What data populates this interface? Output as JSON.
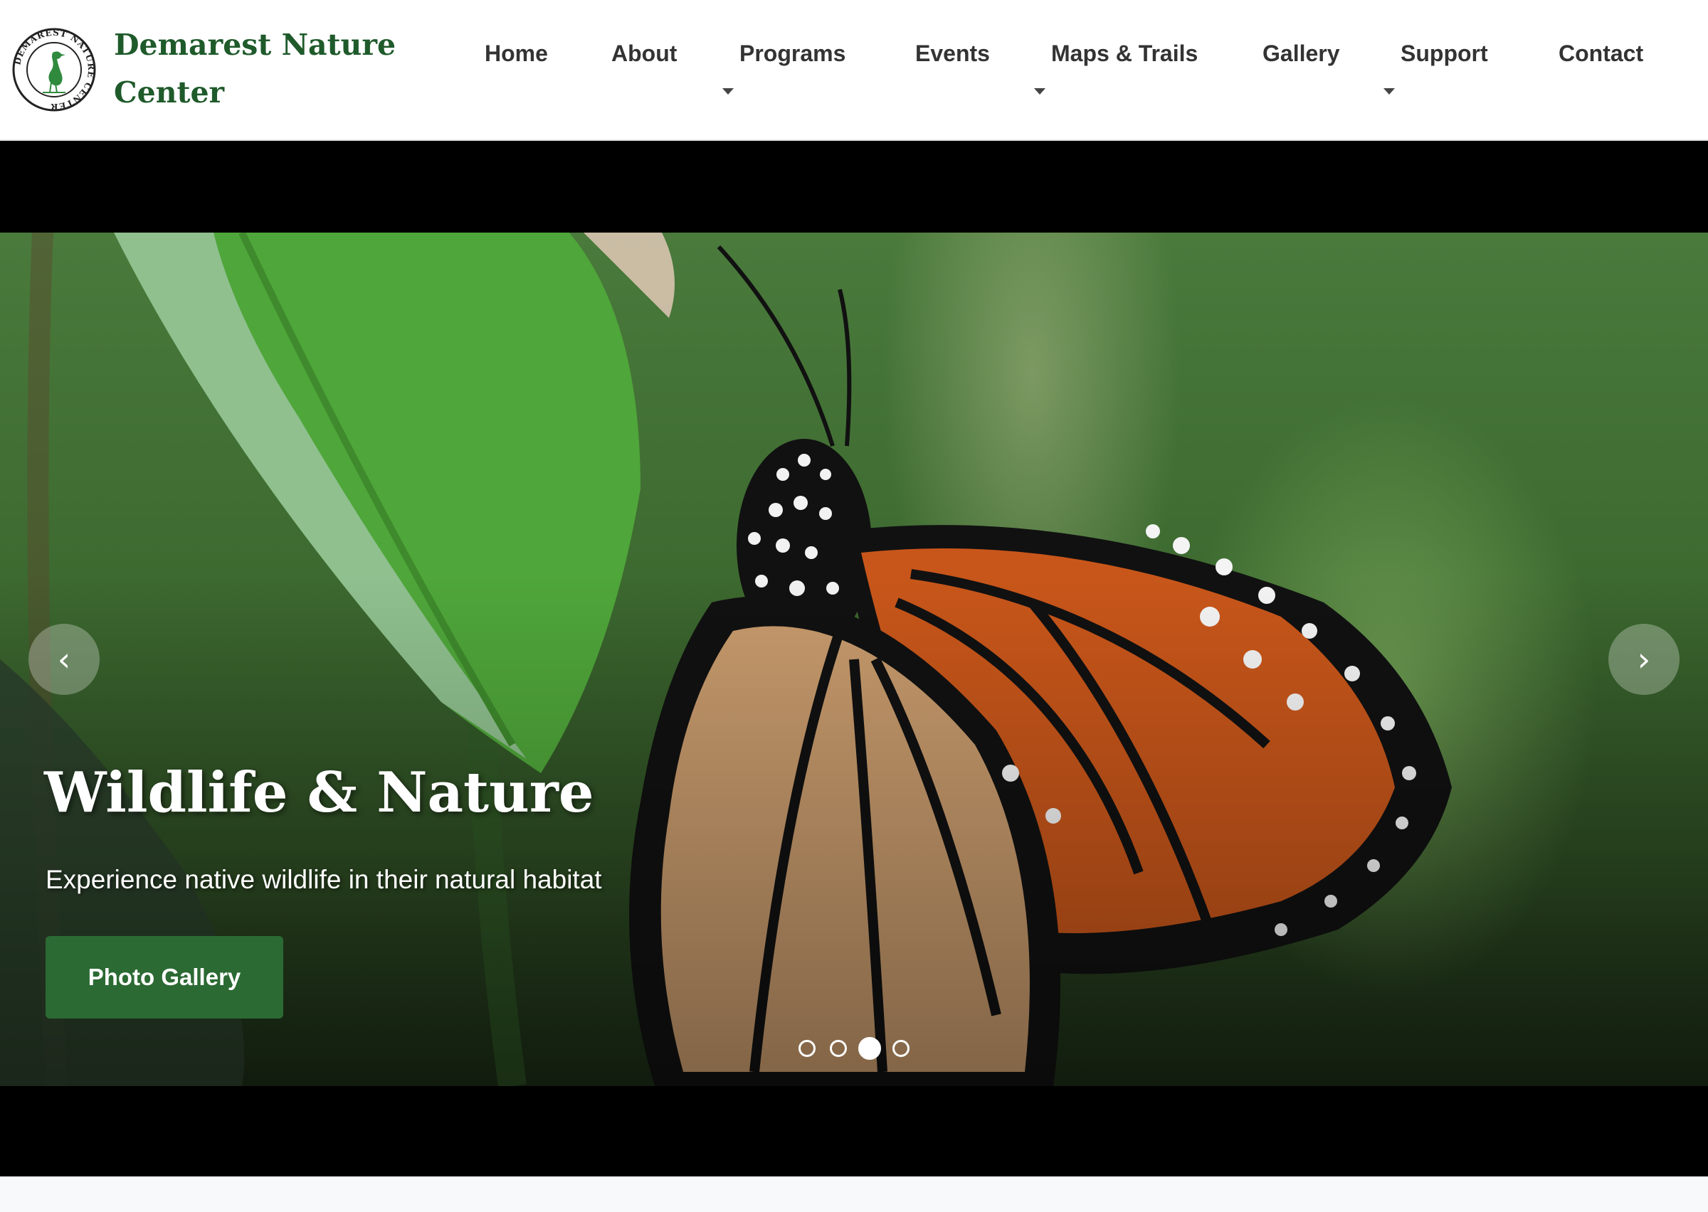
{
  "header": {
    "logo": {
      "icon": "heron-seal-icon",
      "seal_text": "DEMAREST NATURE CENTER"
    },
    "site_title_line1": "Demarest Nature",
    "site_title_line2": "Center",
    "nav": [
      {
        "label": "Home",
        "has_dropdown": false
      },
      {
        "label": "About",
        "has_dropdown": false
      },
      {
        "label": "Programs",
        "has_dropdown": true
      },
      {
        "label": "Events",
        "has_dropdown": false
      },
      {
        "label": "Maps & Trails",
        "has_dropdown": true
      },
      {
        "label": "Gallery",
        "has_dropdown": false
      },
      {
        "label": "Support",
        "has_dropdown": true
      },
      {
        "label": "Contact",
        "has_dropdown": false
      }
    ]
  },
  "hero": {
    "slide": {
      "title": "Wildlife & Nature",
      "subtitle": "Experience native wildlife in their natural habitat",
      "cta_label": "Photo Gallery",
      "image_subject": "monarch butterfly on milkweed leaf"
    },
    "prev_arrow": "‹",
    "next_arrow": "›",
    "slide_count": 4,
    "active_slide": 3
  },
  "colors": {
    "brand_green": "#1f5a2b",
    "button_green": "#2c6a33",
    "nav_text": "#333333",
    "hero_band": "#000000",
    "page_bg": "#f8f9fb"
  }
}
